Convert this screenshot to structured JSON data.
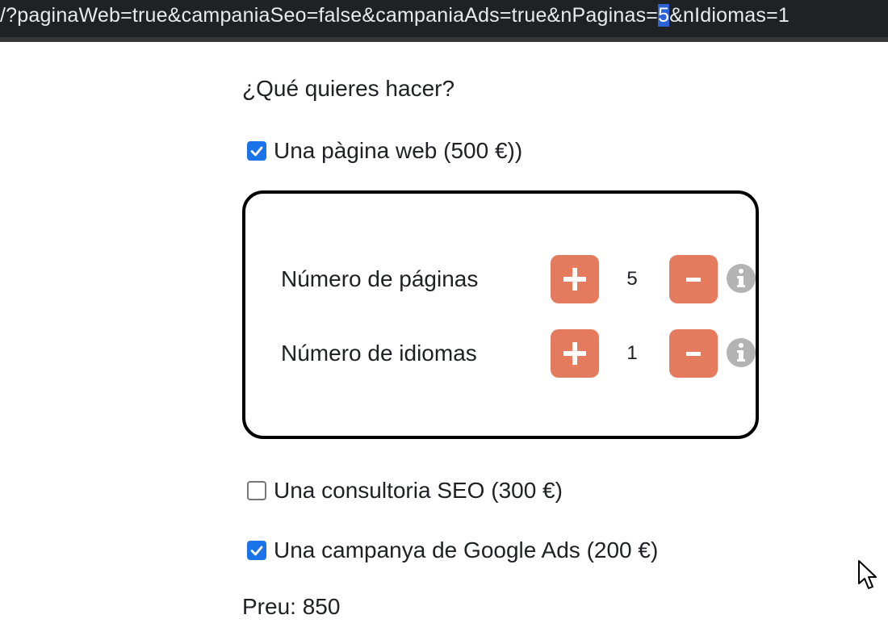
{
  "url": {
    "before": "/?paginaWeb=true&campaniaSeo=false&campaniaAds=true&nPaginas=",
    "selected": "5",
    "after": "&nIdiomas=1"
  },
  "form": {
    "question": "¿Qué quieres hacer?",
    "options": [
      {
        "label": "Una pàgina web (500 €))",
        "checked": true
      },
      {
        "label": "Una consultoria SEO (300 €)",
        "checked": false
      },
      {
        "label": "Una campanya de Google Ads (200 €)",
        "checked": true
      }
    ],
    "web_panel": {
      "rows": [
        {
          "label": "Número de páginas",
          "value": "5",
          "plus": "+",
          "minus": "-"
        },
        {
          "label": "Número de idiomas",
          "value": "1",
          "plus": "+",
          "minus": "-"
        }
      ]
    },
    "price_text": "Preu: 850"
  },
  "colors": {
    "accent_button": "#e57b5e",
    "checkbox_checked": "#1a73e8",
    "info_icon": "#b3b3b3"
  },
  "icons": {
    "plus": "plus-icon",
    "minus": "minus-icon",
    "info": "info-icon",
    "cursor": "mouse-cursor-icon"
  }
}
